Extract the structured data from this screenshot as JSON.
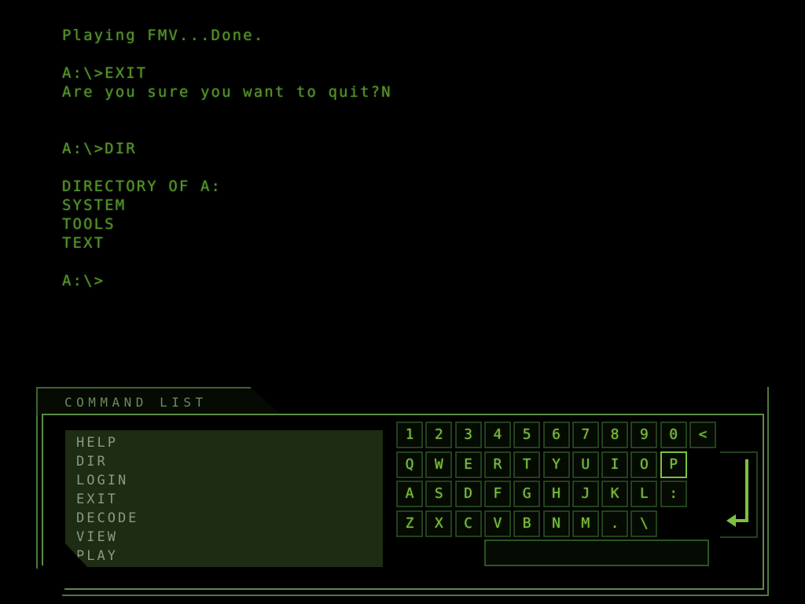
{
  "terminal": {
    "lines": [
      "Playing FMV...Done.",
      "",
      "A:\\>EXIT",
      "Are you sure you want to quit?N",
      "",
      "",
      "A:\\>DIR",
      "",
      "DIRECTORY OF A:",
      "SYSTEM",
      "TOOLS",
      "TEXT",
      "",
      "A:\\>"
    ]
  },
  "console": {
    "tab_label": "COMMAND LIST",
    "command_list": [
      "HELP",
      "DIR",
      "LOGIN",
      "EXIT",
      "DECODE",
      "VIEW",
      "PLAY"
    ],
    "keyboard": {
      "rows": [
        [
          "1",
          "2",
          "3",
          "4",
          "5",
          "6",
          "7",
          "8",
          "9",
          "0",
          "<"
        ],
        [
          "Q",
          "W",
          "E",
          "R",
          "T",
          "Y",
          "U",
          "I",
          "O",
          "P"
        ],
        [
          "A",
          "S",
          "D",
          "F",
          "G",
          "H",
          "J",
          "K",
          "L",
          ":"
        ],
        [
          "Z",
          "X",
          "C",
          "V",
          "B",
          "N",
          "M",
          ".",
          "\\"
        ]
      ],
      "highlighted_key": "P",
      "enter_key": "enter-arrow",
      "spacebar": ""
    }
  },
  "colors": {
    "background": "#000000",
    "terminal_text": "#56962c",
    "key_glyph": "#7cc23f",
    "frame": "#5c8c46",
    "tab_label": "#6e8a62",
    "command_text": "#8a9b80",
    "command_panel_bg": "#1d2c12"
  }
}
